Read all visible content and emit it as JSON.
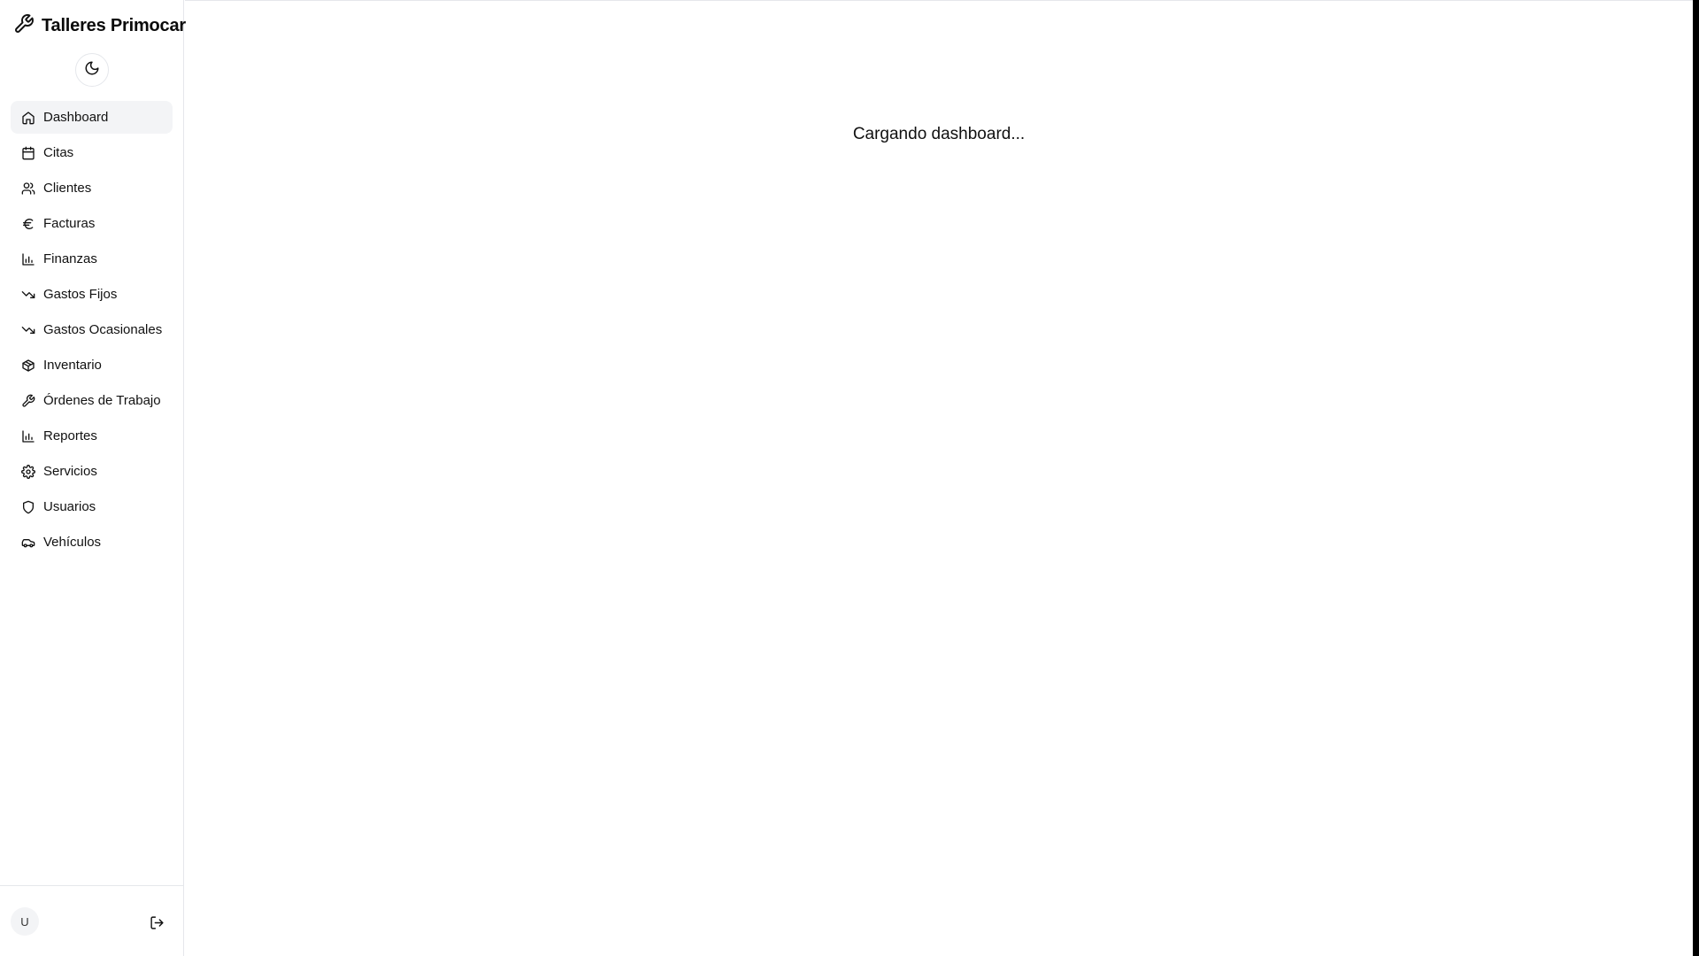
{
  "app": {
    "title": "Talleres Primocar"
  },
  "theme_toggle": {
    "icon": "moon-icon"
  },
  "sidebar": {
    "items": [
      {
        "label": "Dashboard",
        "icon": "home-icon",
        "active": true
      },
      {
        "label": "Citas",
        "icon": "calendar-icon"
      },
      {
        "label": "Clientes",
        "icon": "users-icon"
      },
      {
        "label": "Facturas",
        "icon": "euro-icon"
      },
      {
        "label": "Finanzas",
        "icon": "bar-chart-icon"
      },
      {
        "label": "Gastos Fijos",
        "icon": "trending-down-icon"
      },
      {
        "label": "Gastos Ocasionales",
        "icon": "trending-down-icon"
      },
      {
        "label": "Inventario",
        "icon": "package-icon"
      },
      {
        "label": "Órdenes de Trabajo",
        "icon": "wrench-icon"
      },
      {
        "label": "Reportes",
        "icon": "bar-chart-icon"
      },
      {
        "label": "Servicios",
        "icon": "gear-icon"
      },
      {
        "label": "Usuarios",
        "icon": "shield-icon"
      },
      {
        "label": "Vehículos",
        "icon": "car-icon"
      }
    ]
  },
  "user": {
    "initial": "U"
  },
  "main": {
    "loading_text": "Cargando dashboard..."
  },
  "colors": {
    "active_bg": "#f3f4f6",
    "border": "#e5e7eb",
    "text": "#0a0a0a"
  }
}
